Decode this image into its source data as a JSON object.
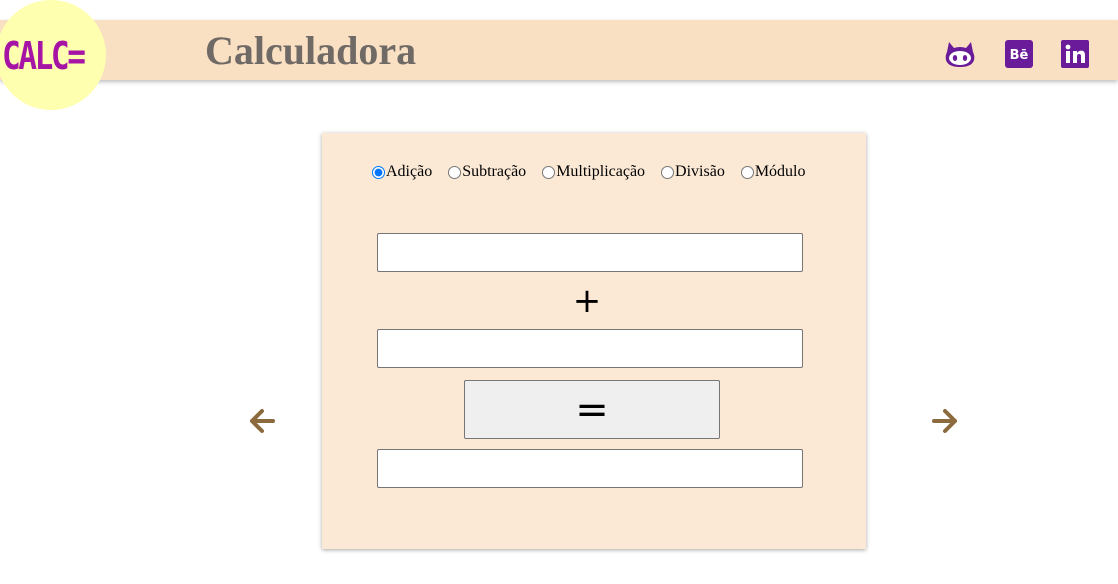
{
  "header": {
    "logo_text": "CALC=",
    "title": "Calculadora",
    "social_icons": [
      "github-icon",
      "behance-icon",
      "linkedin-icon"
    ]
  },
  "operations": [
    {
      "label": "Adição",
      "checked": true
    },
    {
      "label": "Subtração",
      "checked": false
    },
    {
      "label": "Multiplicação",
      "checked": false
    },
    {
      "label": "Divisão",
      "checked": false
    },
    {
      "label": "Módulo",
      "checked": false
    }
  ],
  "calculator": {
    "first_value": "",
    "operator_symbol": "+",
    "second_value": "",
    "equals_label": "=",
    "result_value": ""
  },
  "navigation": {
    "prev_icon": "arrow-left-icon",
    "next_icon": "arrow-right-icon"
  },
  "colors": {
    "header_bg": "#fae0c2",
    "logo_bg": "#ffffb0",
    "logo_text": "#a514a5",
    "title": "#6f6a66",
    "social_icons": "#6a1b9a",
    "panel_bg": "#fbe9d6",
    "arrows": "#8b6b3d"
  }
}
